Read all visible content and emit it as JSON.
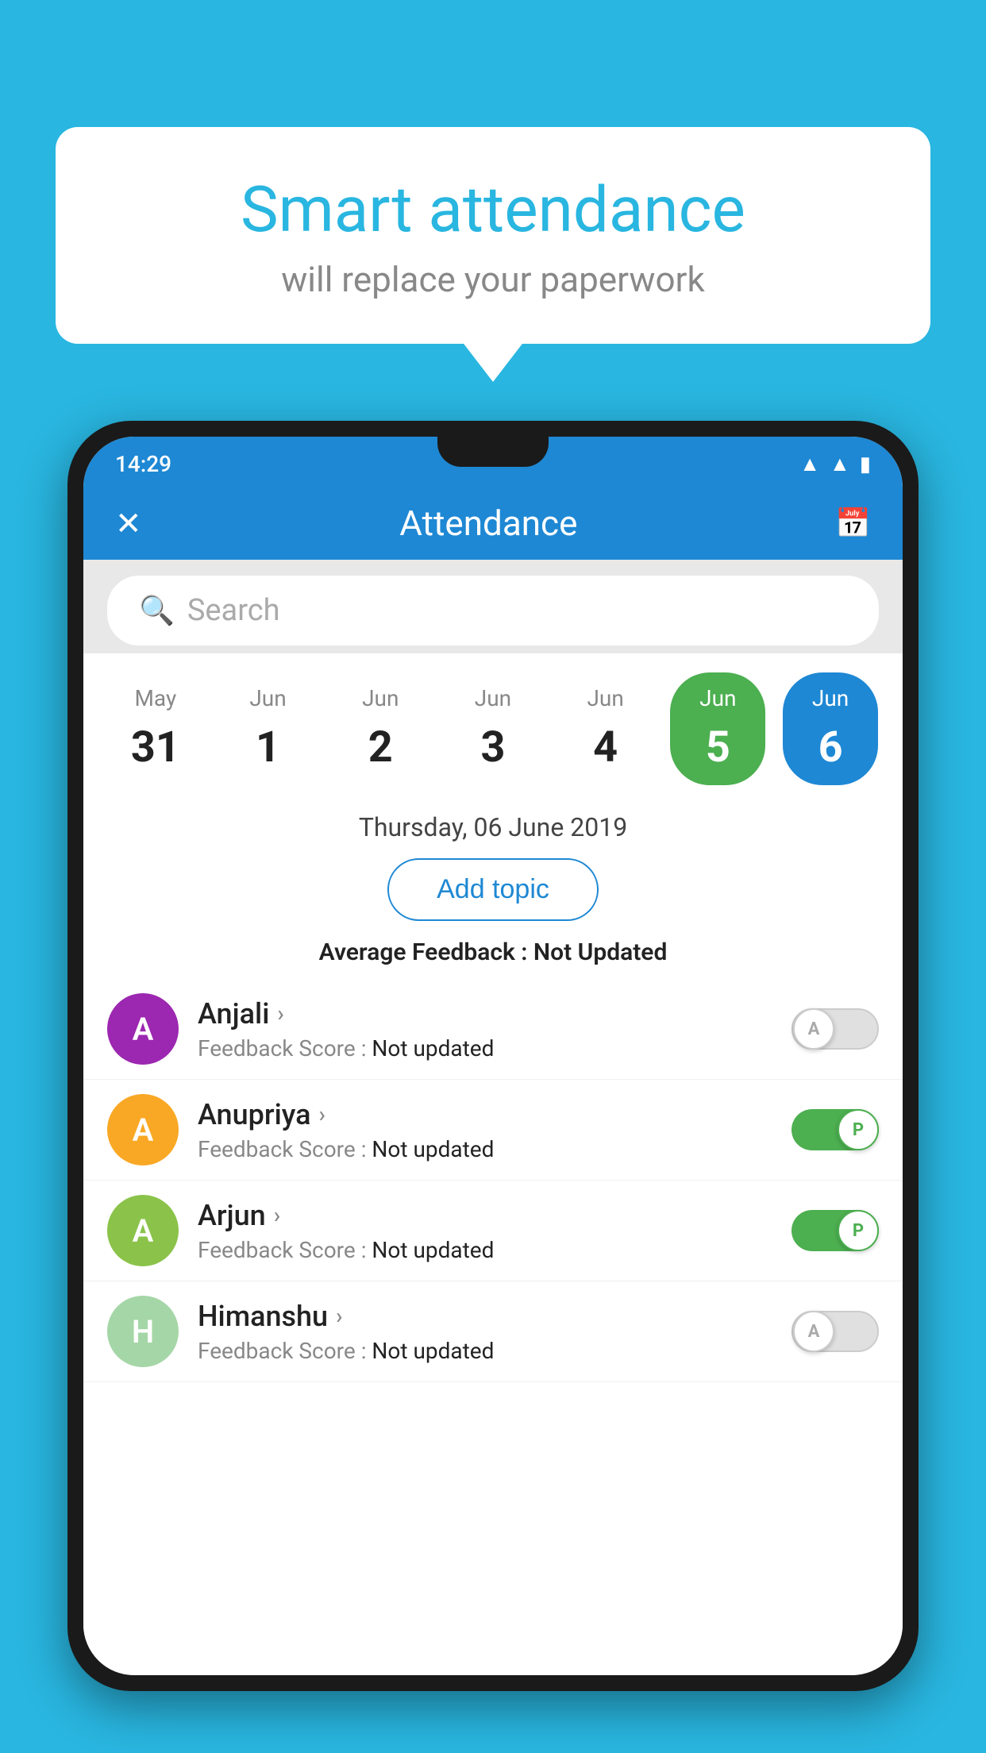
{
  "background_color": "#29b6e0",
  "speech_bubble": {
    "title": "Smart attendance",
    "subtitle": "will replace your paperwork"
  },
  "status_bar": {
    "time": "14:29",
    "icons": [
      "wifi",
      "signal",
      "battery"
    ]
  },
  "app_bar": {
    "title": "Attendance",
    "close_icon": "✕",
    "calendar_icon": "📅"
  },
  "search": {
    "placeholder": "Search"
  },
  "calendar": {
    "days": [
      {
        "month": "May",
        "date": "31",
        "state": "normal"
      },
      {
        "month": "Jun",
        "date": "1",
        "state": "normal"
      },
      {
        "month": "Jun",
        "date": "2",
        "state": "normal"
      },
      {
        "month": "Jun",
        "date": "3",
        "state": "normal"
      },
      {
        "month": "Jun",
        "date": "4",
        "state": "normal"
      },
      {
        "month": "Jun",
        "date": "5",
        "state": "today"
      },
      {
        "month": "Jun",
        "date": "6",
        "state": "selected"
      }
    ]
  },
  "selected_date": "Thursday, 06 June 2019",
  "add_topic_label": "Add topic",
  "avg_feedback_label": "Average Feedback :",
  "avg_feedback_value": "Not Updated",
  "students": [
    {
      "name": "Anjali",
      "avatar_letter": "A",
      "avatar_color": "#9c27b0",
      "feedback_label": "Feedback Score :",
      "feedback_value": "Not updated",
      "toggle_state": "off",
      "toggle_letter": "A"
    },
    {
      "name": "Anupriya",
      "avatar_letter": "A",
      "avatar_color": "#f9a825",
      "feedback_label": "Feedback Score :",
      "feedback_value": "Not updated",
      "toggle_state": "on",
      "toggle_letter": "P"
    },
    {
      "name": "Arjun",
      "avatar_letter": "A",
      "avatar_color": "#8bc34a",
      "feedback_label": "Feedback Score :",
      "feedback_value": "Not updated",
      "toggle_state": "on",
      "toggle_letter": "P"
    },
    {
      "name": "Himanshu",
      "avatar_letter": "H",
      "avatar_color": "#a5d6a7",
      "feedback_label": "Feedback Score :",
      "feedback_value": "Not updated",
      "toggle_state": "off",
      "toggle_letter": "A"
    }
  ]
}
